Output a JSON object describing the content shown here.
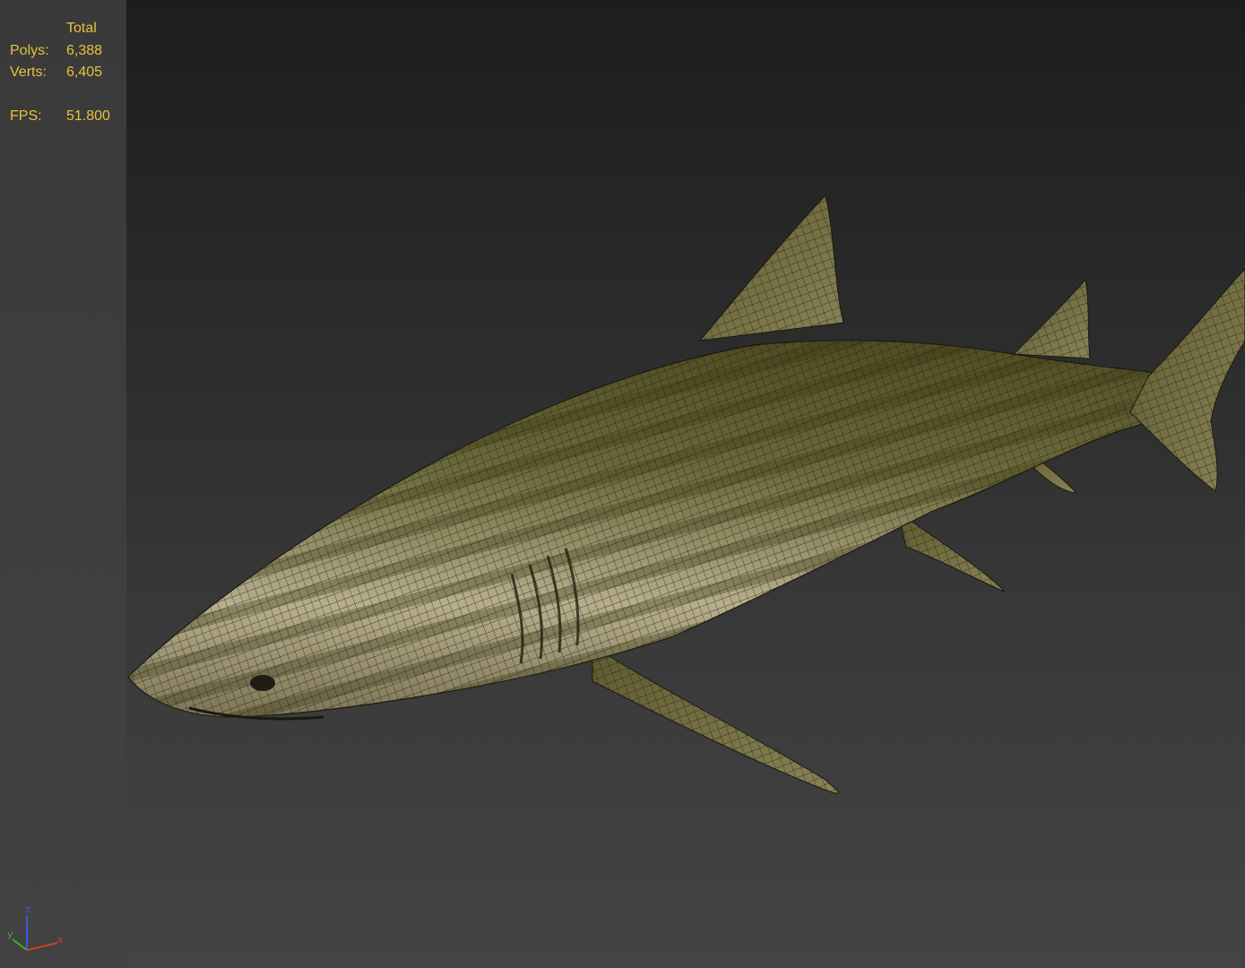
{
  "stats": {
    "header": "Total",
    "rows": [
      {
        "label": "Polys:",
        "value": "6,388"
      },
      {
        "label": "Verts:",
        "value": "6,405"
      }
    ],
    "fps": {
      "label": "FPS:",
      "value": "51.800"
    }
  },
  "axis_gizmo": {
    "x_label": "x",
    "y_label": "y",
    "z_label": "z",
    "x_color": "#d23b2a",
    "y_color": "#3fae2a",
    "z_color": "#3a5be0"
  },
  "colors": {
    "stats_text": "#e6c33a",
    "panel": "#3a3a3a"
  }
}
